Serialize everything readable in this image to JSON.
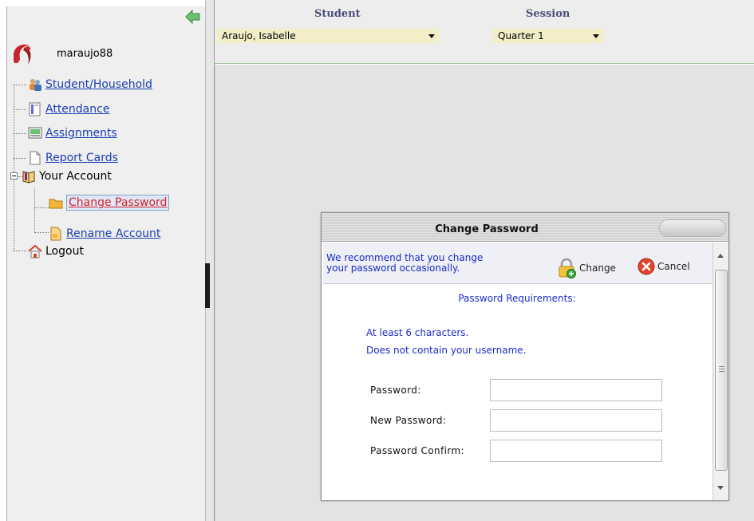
{
  "sidebar": {
    "username": "maraujo88",
    "items": [
      {
        "label": "Student/Household",
        "icon": "student-household-icon"
      },
      {
        "label": "Attendance",
        "icon": "attendance-icon"
      },
      {
        "label": "Assignments",
        "icon": "assignments-icon"
      },
      {
        "label": "Report Cards",
        "icon": "report-cards-icon"
      },
      {
        "label": "Your Account",
        "icon": "your-account-icon"
      },
      {
        "label": "Change Password",
        "icon": "change-password-icon"
      },
      {
        "label": "Rename Account",
        "icon": "rename-account-icon"
      },
      {
        "label": "Logout",
        "icon": "home-icon"
      }
    ]
  },
  "topbar": {
    "student_label": "Student",
    "student_value": "Araujo, Isabelle",
    "session_label": "Session",
    "session_value": "Quarter 1"
  },
  "dialog": {
    "title": "Change Password",
    "recommend_line1": "We recommend that you change",
    "recommend_line2": "your password occasionally.",
    "change_label": "Change",
    "cancel_label": "Cancel",
    "requirements_heading": "Password Requirements:",
    "requirements": [
      "At least 6 characters.",
      "Does not contain your username."
    ],
    "fields": [
      {
        "label": "Password:",
        "value": ""
      },
      {
        "label": "New Password:",
        "value": ""
      },
      {
        "label": "Password Confirm:",
        "value": ""
      }
    ]
  },
  "colors": {
    "link": "#1a3fb3",
    "active_link": "#d62222",
    "dialog_text": "#1a2cc9",
    "select_bg": "#f3eec8"
  }
}
